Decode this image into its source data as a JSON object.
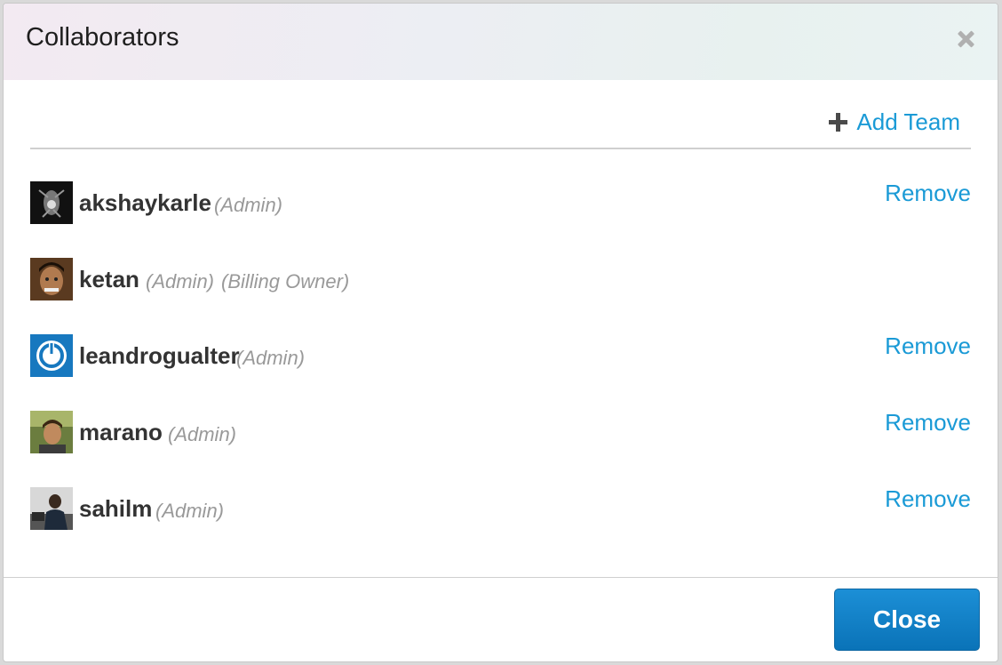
{
  "dialog": {
    "title": "Collaborators",
    "add_team_label": "Add Team",
    "close_button_label": "Close"
  },
  "collaborators": [
    {
      "username": "akshaykarle",
      "roles": [
        "(Admin)"
      ],
      "action": "Remove"
    },
    {
      "username": "ketan",
      "roles": [
        "(Admin)",
        "(Billing Owner)"
      ],
      "action": ""
    },
    {
      "username": "leandrogualter",
      "roles": [
        "(Admin)"
      ],
      "action": "Remove"
    },
    {
      "username": "marano",
      "roles": [
        "(Admin)"
      ],
      "action": "Remove"
    },
    {
      "username": "sahilm",
      "roles": [
        "(Admin)"
      ],
      "action": "Remove"
    }
  ],
  "colors": {
    "link": "#1a9ad6",
    "primary_button": "#0a73b8",
    "role_text": "#999999"
  }
}
